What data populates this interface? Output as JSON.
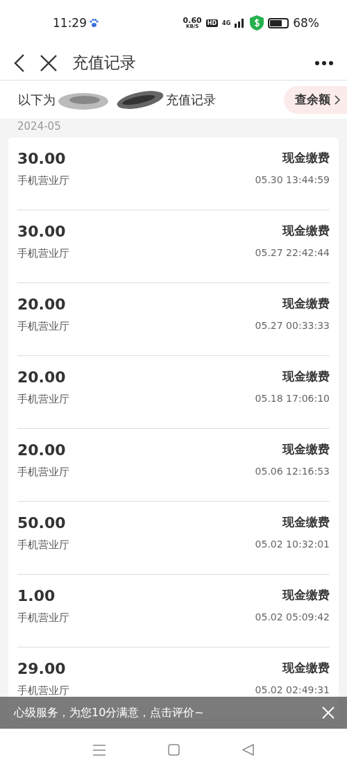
{
  "status_bar": {
    "time": "11:29",
    "speed": "0.60",
    "speed_unit": "KB/S",
    "hd": "HD",
    "network": "4G",
    "battery": "68%"
  },
  "header": {
    "title": "充值记录"
  },
  "subtitle": {
    "prefix": "以下为",
    "suffix": "充值记录",
    "balance_button": "查余额"
  },
  "month": "2024-05",
  "records": [
    {
      "amount": "30.00",
      "type": "现金缴费",
      "channel": "手机营业厅",
      "time": "05.30 13:44:59"
    },
    {
      "amount": "30.00",
      "type": "现金缴费",
      "channel": "手机营业厅",
      "time": "05.27 22:42:44"
    },
    {
      "amount": "20.00",
      "type": "现金缴费",
      "channel": "手机营业厅",
      "time": "05.27 00:33:33"
    },
    {
      "amount": "20.00",
      "type": "现金缴费",
      "channel": "手机营业厅",
      "time": "05.18 17:06:10"
    },
    {
      "amount": "20.00",
      "type": "现金缴费",
      "channel": "手机营业厅",
      "time": "05.06 12:16:53"
    },
    {
      "amount": "50.00",
      "type": "现金缴费",
      "channel": "手机营业厅",
      "time": "05.02 10:32:01"
    },
    {
      "amount": "1.00",
      "type": "现金缴费",
      "channel": "手机营业厅",
      "time": "05.02 05:09:42"
    },
    {
      "amount": "29.00",
      "type": "现金缴费",
      "channel": "手机营业厅",
      "time": "05.02 02:49:31"
    }
  ],
  "banner": {
    "text": "心级服务，为您10分满意，点击评价~"
  }
}
